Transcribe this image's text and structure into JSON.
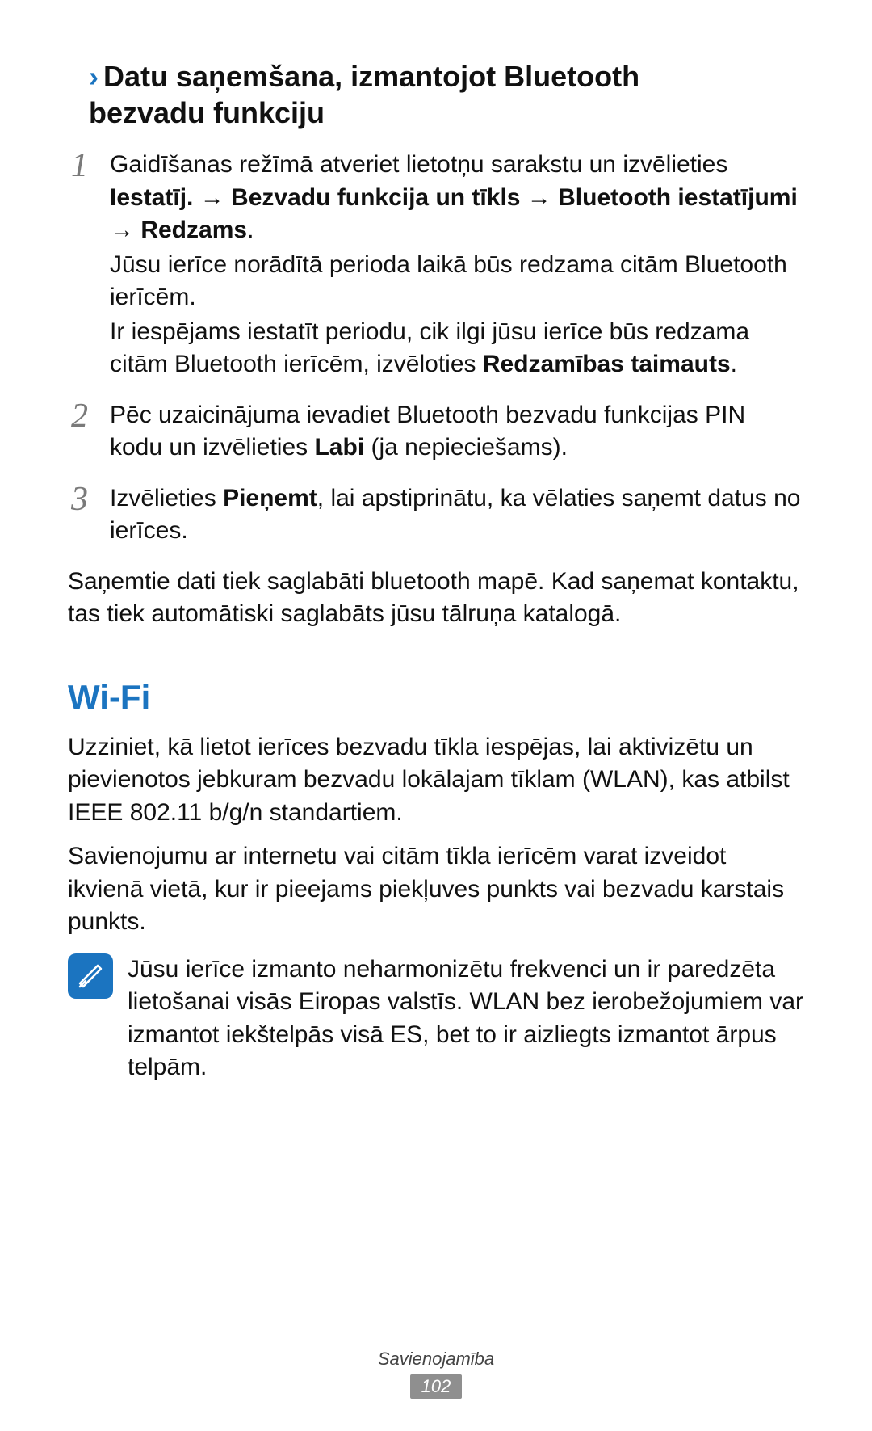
{
  "heading": {
    "chevron": "›",
    "line1": "Datu saņemšana, izmantojot Bluetooth",
    "line2": "bezvadu funkciju"
  },
  "steps": [
    {
      "num": "1",
      "p1_a": "Gaidīšanas režīmā atveriet lietotņu sarakstu un izvēlieties ",
      "p1_b": "Iestatīj. → Bezvadu funkcija un tīkls → Bluetooth iestatījumi → Redzams",
      "p1_c": ".",
      "p2": "Jūsu ierīce norādītā perioda laikā būs redzama citām Bluetooth ierīcēm.",
      "p3_a": "Ir iespējams iestatīt periodu, cik ilgi jūsu ierīce būs redzama citām Bluetooth ierīcēm, izvēloties ",
      "p3_b": "Redzamības taimauts",
      "p3_c": "."
    },
    {
      "num": "2",
      "p1_a": "Pēc uzaicinājuma ievadiet Bluetooth bezvadu funkcijas PIN kodu un izvēlieties ",
      "p1_b": "Labi",
      "p1_c": " (ja nepieciešams)."
    },
    {
      "num": "3",
      "p1_a": "Izvēlieties ",
      "p1_b": "Pieņemt",
      "p1_c": ", lai apstiprinātu, ka vēlaties saņemt datus no ierīces."
    }
  ],
  "after_steps": "Saņemtie dati tiek saglabāti bluetooth mapē. Kad saņemat kontaktu, tas tiek automātiski saglabāts jūsu tālruņa katalogā.",
  "wifi_heading": "Wi-Fi",
  "wifi_para1": "Uzziniet, kā lietot ierīces bezvadu tīkla iespējas, lai aktivizētu un pievienotos jebkuram bezvadu lokālajam tīklam (WLAN), kas atbilst IEEE 802.11 b/g/n standartiem.",
  "wifi_para2": "Savienojumu ar internetu vai citām tīkla ierīcēm varat izveidot ikvienā vietā, kur ir pieejams piekļuves punkts vai bezvadu karstais punkts.",
  "note_text": "Jūsu ierīce izmanto neharmonizētu frekvenci un ir paredzēta lietošanai visās Eiropas valstīs. WLAN bez ierobežojumiem var izmantot iekštelpās visā ES, bet to ir aizliegts izmantot ārpus telpām.",
  "footer_label": "Savienojamība",
  "page_number": "102"
}
